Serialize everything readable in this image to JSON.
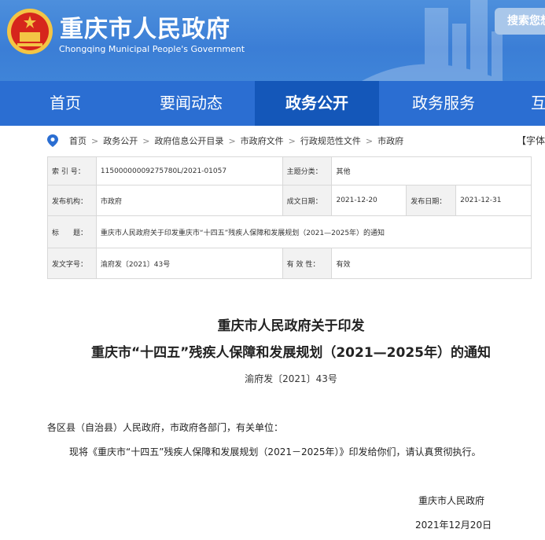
{
  "header": {
    "title": "重庆市人民政府",
    "subtitle": "Chongqing Municipal People's Government",
    "search_label": "搜索您想"
  },
  "nav": {
    "items": [
      "首页",
      "要闻动态",
      "政务公开",
      "政务服务",
      "互"
    ]
  },
  "breadcrumb": {
    "items": [
      "首页",
      "政务公开",
      "政府信息公开目录",
      "市政府文件",
      "行政规范性文件",
      "市政府"
    ],
    "separator": ">",
    "font_control": "【字体"
  },
  "info": {
    "index_label": "索 引 号：",
    "index_value": "11500000009275780L/2021-01057",
    "category_label": "主题分类：",
    "category_value": "其他",
    "issuer_label": "发布机构：",
    "issuer_value": "市政府",
    "created_label": "成文日期：",
    "created_value": "2021-12-20",
    "published_label": "发布日期：",
    "published_value": "2021-12-31",
    "title_label": "标　　题：",
    "title_value": "重庆市人民政府关于印发重庆市“十四五”残疾人保障和发展规划（2021—2025年）的通知",
    "docno_label": "发文字号：",
    "docno_value": "渝府发〔2021〕43号",
    "validity_label": "有 效 性：",
    "validity_value": "有效"
  },
  "document": {
    "title_line1": "重庆市人民政府关于印发",
    "title_line2": "重庆市“十四五”残疾人保障和发展规划（2021—2025年）的通知",
    "doc_number": "渝府发〔2021〕43号",
    "addressee": "各区县（自治县）人民政府，市政府各部门，有关单位：",
    "body": "现将《重庆市“十四五”残疾人保障和发展规划（2021－2025年）》印发给你们，请认真贯彻执行。",
    "sign_org": "重庆市人民政府",
    "sign_date": "2021年12月20日"
  },
  "colors": {
    "header_blue": "#3b7ed6",
    "nav_blue": "#2b6ed2",
    "nav_active": "#1457b9",
    "emblem_red": "#d6261c",
    "emblem_gold": "#f3c545"
  }
}
